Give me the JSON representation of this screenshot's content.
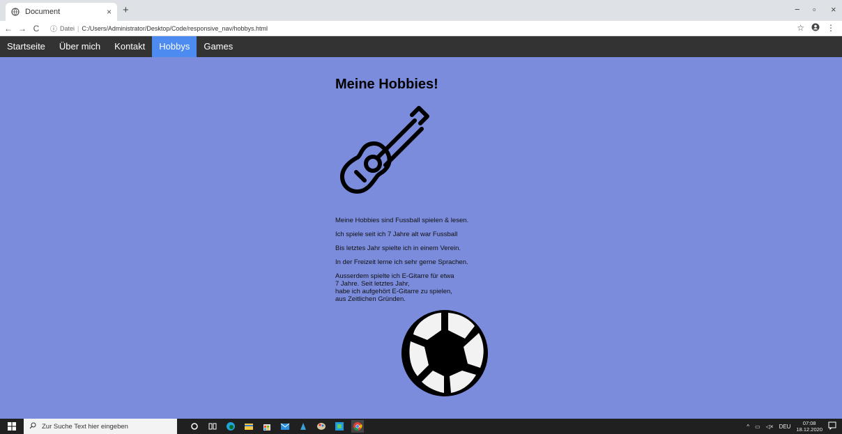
{
  "browser": {
    "tab_title": "Document",
    "tab_close": "×",
    "new_tab": "+",
    "nav_back": "←",
    "nav_forward": "→",
    "nav_reload": "C",
    "url_label": "Datei",
    "url": "C:/Users/Administrator/Desktop/Code/responsive_nav/hobbys.html",
    "window_minimize": "−",
    "window_restore": "▫",
    "window_close": "×"
  },
  "nav": {
    "items": [
      {
        "label": "Startseite"
      },
      {
        "label": "Über mich"
      },
      {
        "label": "Kontakt"
      },
      {
        "label": "Hobbys",
        "active": true
      },
      {
        "label": "Games"
      }
    ],
    "background": "#333333",
    "active_color": "#4d8bf0"
  },
  "page": {
    "background": "#7b8cdc",
    "heading": "Meine Hobbies!",
    "paragraphs": [
      [
        "Meine Hobbies sind Fussball spielen & lesen."
      ],
      [
        "Ich spiele seit ich 7 Jahre alt war Fussball"
      ],
      [
        "Bis letztes Jahr spielte ich in einem Verein."
      ],
      [
        "In der Freizeit lerne ich sehr gerne Sprachen."
      ],
      [
        "Ausserdem spielte ich E-Gitarre für etwa",
        "7 Jahre. Seit letztes Jahr,",
        "habe ich aufgehört E-Gitarre zu spielen,",
        "aus Zeitlichen Gründen."
      ]
    ],
    "images": [
      "guitar-icon",
      "soccer-ball-icon"
    ]
  },
  "taskbar": {
    "search_placeholder": "Zur Suche Text hier eingeben",
    "language": "DEU",
    "time": "07:08",
    "date": "18.12.2020"
  }
}
